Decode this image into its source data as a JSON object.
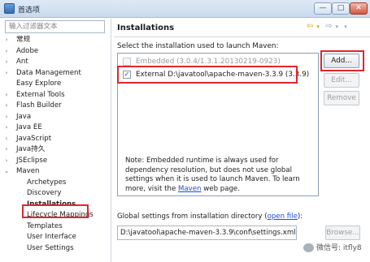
{
  "window": {
    "title": "首选项",
    "min": "—",
    "max": "□",
    "close": "✕"
  },
  "filter": {
    "placeholder": "输入过滤器文本"
  },
  "tree": [
    {
      "label": "常规",
      "arrow": "›"
    },
    {
      "label": "Adobe",
      "arrow": "›"
    },
    {
      "label": "Ant",
      "arrow": "›"
    },
    {
      "label": "Data Management",
      "arrow": "›"
    },
    {
      "label": "Easy Explore",
      "arrow": ""
    },
    {
      "label": "External Tools",
      "arrow": "›"
    },
    {
      "label": "Flash Builder",
      "arrow": "›"
    },
    {
      "label": "Java",
      "arrow": "›"
    },
    {
      "label": "Java EE",
      "arrow": "›"
    },
    {
      "label": "JavaScript",
      "arrow": "›"
    },
    {
      "label": "Java持久",
      "arrow": "›"
    },
    {
      "label": "JSEclipse",
      "arrow": "›"
    },
    {
      "label": "Maven",
      "arrow": "⌄"
    },
    {
      "label": "Archetypes",
      "arrow": ""
    },
    {
      "label": "Discovery",
      "arrow": ""
    },
    {
      "label": "Installations",
      "arrow": ""
    },
    {
      "label": "Lifecycle Mappings",
      "arrow": ""
    },
    {
      "label": "Templates",
      "arrow": ""
    },
    {
      "label": "User Interface",
      "arrow": ""
    },
    {
      "label": "User Settings",
      "arrow": ""
    }
  ],
  "page": {
    "title": "Installations",
    "description": "Select the installation used to launch Maven:",
    "installations": [
      {
        "label": "Embedded (3.0.4/1.3.1.20130219-0923)",
        "checked": false,
        "enabled": false
      },
      {
        "label": "External D:\\javatool\\apache-maven-3.3.9 (3.3.9)",
        "checked": true,
        "enabled": true
      }
    ],
    "buttons": {
      "add": "Add...",
      "edit": "Edit...",
      "remove": "Remove",
      "browse": "Browse..."
    },
    "note_part1": "Note: Embedded runtime is always used for dependency resolution, but does not use global settings when it is used to launch Maven. To learn more, visit the ",
    "note_link": "Maven",
    "note_part2": " web page.",
    "global_label": "Global settings from installation directory (",
    "global_link": "open file",
    "global_label_end": "):",
    "settings_path": "D:\\javatool\\apache-maven-3.3.9\\conf\\settings.xml"
  },
  "watermark": "微信号: itfly8",
  "colors": {
    "highlight": "#e0262d",
    "link": "#1b4fd1"
  }
}
